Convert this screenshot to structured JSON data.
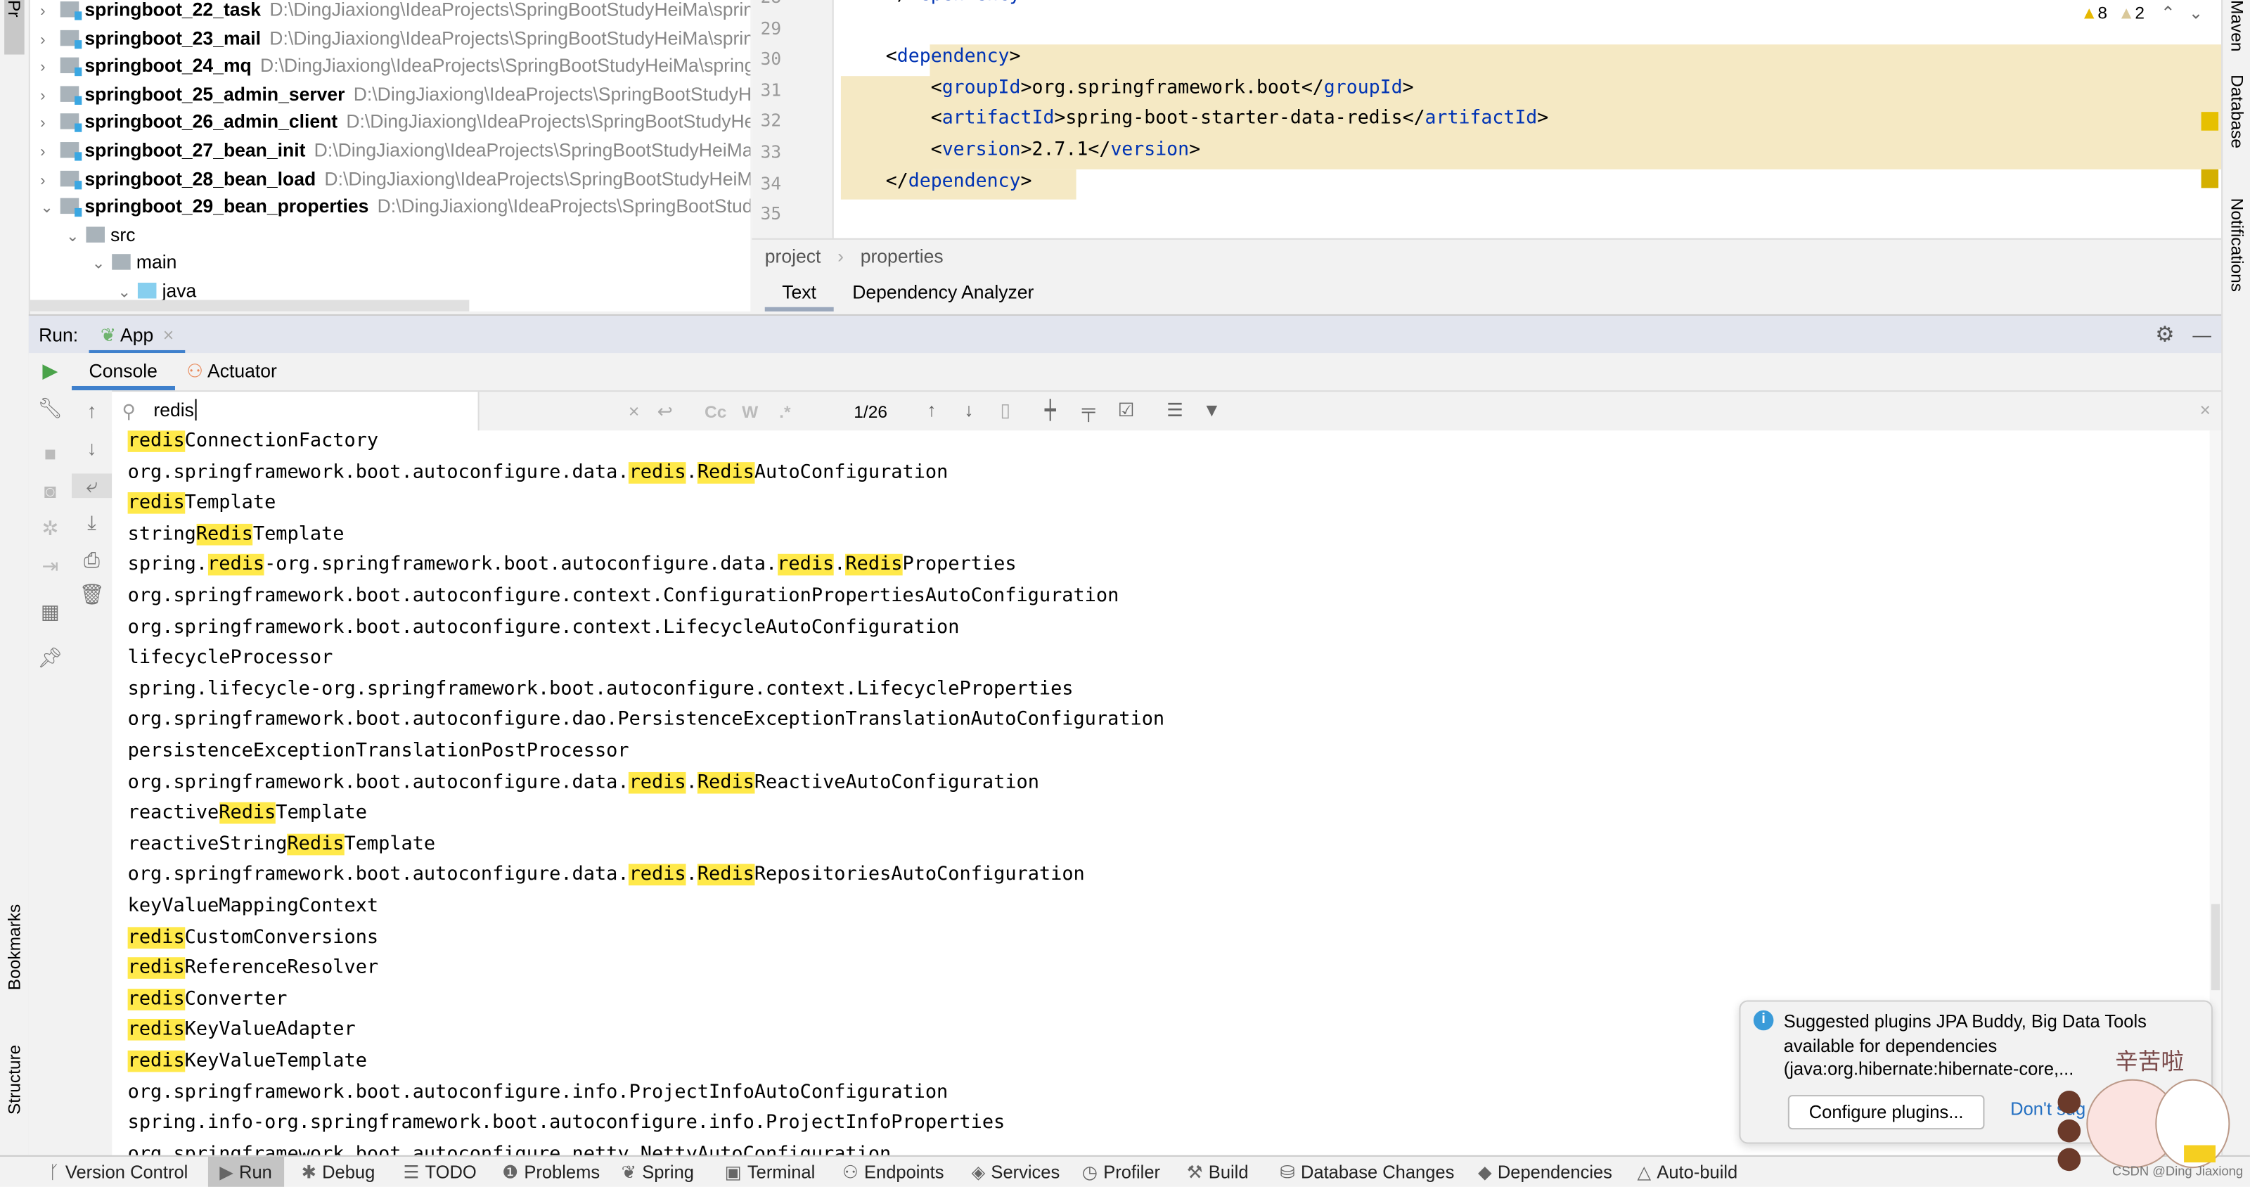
{
  "left_strip": {
    "project_label": "Pr",
    "bookmarks_label": "Bookmarks",
    "structure_label": "Structure"
  },
  "project_tree": [
    {
      "name": "springboot_22_task",
      "path": "D:\\DingJiaxiong\\IdeaProjects\\SpringBootStudyHeiMa\\spring",
      "expanded": false,
      "level": 0
    },
    {
      "name": "springboot_23_mail",
      "path": "D:\\DingJiaxiong\\IdeaProjects\\SpringBootStudyHeiMa\\spring",
      "expanded": false,
      "level": 0
    },
    {
      "name": "springboot_24_mq",
      "path": "D:\\DingJiaxiong\\IdeaProjects\\SpringBootStudyHeiMa\\springb",
      "expanded": false,
      "level": 0
    },
    {
      "name": "springboot_25_admin_server",
      "path": "D:\\DingJiaxiong\\IdeaProjects\\SpringBootStudyHei",
      "expanded": false,
      "level": 0
    },
    {
      "name": "springboot_26_admin_client",
      "path": "D:\\DingJiaxiong\\IdeaProjects\\SpringBootStudyHeiM",
      "expanded": false,
      "level": 0
    },
    {
      "name": "springboot_27_bean_init",
      "path": "D:\\DingJiaxiong\\IdeaProjects\\SpringBootStudyHeiMa\\s",
      "expanded": false,
      "level": 0
    },
    {
      "name": "springboot_28_bean_load",
      "path": "D:\\DingJiaxiong\\IdeaProjects\\SpringBootStudyHeiMa\\",
      "expanded": false,
      "level": 0
    },
    {
      "name": "springboot_29_bean_properties",
      "path": "D:\\DingJiaxiong\\IdeaProjects\\SpringBootStudyH",
      "expanded": true,
      "level": 0
    },
    {
      "name": "src",
      "path": "",
      "expanded": true,
      "level": 1
    },
    {
      "name": "main",
      "path": "",
      "expanded": true,
      "level": 2
    },
    {
      "name": "java",
      "path": "",
      "expanded": true,
      "level": 3
    }
  ],
  "editor": {
    "lines": [
      {
        "num": "28",
        "code": "    </dependency>"
      },
      {
        "num": "29",
        "code": ""
      },
      {
        "num": "30",
        "code": "    <dependency>"
      },
      {
        "num": "31",
        "code": "        <groupId>org.springframework.boot</groupId>"
      },
      {
        "num": "32",
        "code": "        <artifactId>spring-boot-starter-data-redis</artifactId>"
      },
      {
        "num": "33",
        "code": "        <version>2.7.1</version>"
      },
      {
        "num": "34",
        "code": "    </dependency>"
      },
      {
        "num": "35",
        "code": ""
      }
    ],
    "warnings": "8",
    "weak_warnings": "2",
    "breadcrumb": [
      "project",
      "properties"
    ],
    "tabs": [
      "Text",
      "Dependency Analyzer"
    ],
    "active_tab": "Text"
  },
  "right_strip": {
    "maven": "Maven",
    "database": "Database",
    "notifications": "Notifications"
  },
  "run": {
    "label": "Run:",
    "tab": "App",
    "console_tabs": [
      "Console",
      "Actuator"
    ]
  },
  "search": {
    "query": "redis",
    "match": "1/26",
    "case_label": "Cc",
    "word_label": "W",
    "regex_label": ".*"
  },
  "highlight_term": "redis",
  "console_lines": [
    "redisConnectionFactory",
    "org.springframework.boot.autoconfigure.data.redis.RedisAutoConfiguration",
    "redisTemplate",
    "stringRedisTemplate",
    "spring.redis-org.springframework.boot.autoconfigure.data.redis.RedisProperties",
    "org.springframework.boot.autoconfigure.context.ConfigurationPropertiesAutoConfiguration",
    "org.springframework.boot.autoconfigure.context.LifecycleAutoConfiguration",
    "lifecycleProcessor",
    "spring.lifecycle-org.springframework.boot.autoconfigure.context.LifecycleProperties",
    "org.springframework.boot.autoconfigure.dao.PersistenceExceptionTranslationAutoConfiguration",
    "persistenceExceptionTranslationPostProcessor",
    "org.springframework.boot.autoconfigure.data.redis.RedisReactiveAutoConfiguration",
    "reactiveRedisTemplate",
    "reactiveStringRedisTemplate",
    "org.springframework.boot.autoconfigure.data.redis.RedisRepositoriesAutoConfiguration",
    "keyValueMappingContext",
    "redisCustomConversions",
    "redisReferenceResolver",
    "redisConverter",
    "redisKeyValueAdapter",
    "redisKeyValueTemplate",
    "org.springframework.boot.autoconfigure.info.ProjectInfoAutoConfiguration",
    "spring.info-org.springframework.boot.autoconfigure.info.ProjectInfoProperties",
    "org.springframework.boot.autoconfigure.netty.NettyAutoConfiguration"
  ],
  "notification": {
    "text1": "Suggested plugins JPA Buddy, Big Data Tools",
    "text2": "available for dependencies",
    "text3": "(java:org.hibernate:hibernate-core,...",
    "configure": "Configure plugins...",
    "dont": "Don't sug"
  },
  "watermark": "CSDN @Ding Jiaxiong",
  "sticker_text": "辛苦啦",
  "status_bar": [
    {
      "label": "Version Control",
      "icon": "branch-icon"
    },
    {
      "label": "Run",
      "icon": "play-icon",
      "active": true
    },
    {
      "label": "Debug",
      "icon": "bug-icon"
    },
    {
      "label": "TODO",
      "icon": "list-icon"
    },
    {
      "label": "Problems",
      "icon": "problems-icon"
    },
    {
      "label": "Spring",
      "icon": "spring-icon"
    },
    {
      "label": "Terminal",
      "icon": "terminal-icon"
    },
    {
      "label": "Endpoints",
      "icon": "endpoints-icon"
    },
    {
      "label": "Services",
      "icon": "services-icon"
    },
    {
      "label": "Profiler",
      "icon": "profiler-icon"
    },
    {
      "label": "Build",
      "icon": "hammer-icon"
    },
    {
      "label": "Database Changes",
      "icon": "database-icon"
    },
    {
      "label": "Dependencies",
      "icon": "dependencies-icon"
    },
    {
      "label": "Auto-build",
      "icon": "warning-icon"
    }
  ],
  "colors": {
    "match_highlight": "#ffe94a",
    "selection": "#f5e9c4",
    "accent": "#3f80cc",
    "xml_tag": "#0033b3"
  }
}
